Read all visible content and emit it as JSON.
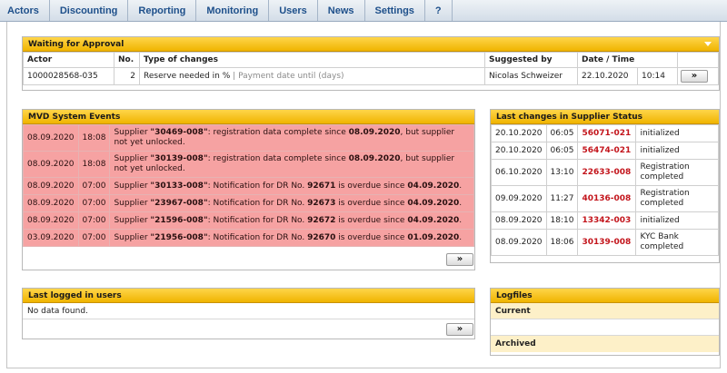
{
  "nav": {
    "items": [
      {
        "label": "Actors"
      },
      {
        "label": "Discounting"
      },
      {
        "label": "Reporting"
      },
      {
        "label": "Monitoring"
      },
      {
        "label": "Users"
      },
      {
        "label": "News"
      },
      {
        "label": "Settings"
      },
      {
        "label": "?"
      }
    ]
  },
  "approval": {
    "title": "Waiting for Approval",
    "columns": {
      "actor": "Actor",
      "no": "No.",
      "type": "Type of changes",
      "suggested": "Suggested by",
      "datetime": "Date / Time"
    },
    "rows": [
      {
        "actor": "1000028568-035",
        "no": "2",
        "type_main": "Reserve needed in %",
        "separator": "|",
        "type_secondary": "Payment date until (days)",
        "suggested_by": "Nicolas Schweizer",
        "date": "22.10.2020",
        "time": "10:14"
      }
    ],
    "more_label": "»"
  },
  "events": {
    "title": "MVD System Events",
    "rows": [
      {
        "date": "08.09.2020",
        "time": "18:08",
        "p1": "Supplier ",
        "id": "\"30469-008\"",
        "p2": ": registration data complete since ",
        "d2": "08.09.2020",
        "p3": ", but supplier not yet unlocked.",
        "p4": "",
        "p5": ""
      },
      {
        "date": "08.09.2020",
        "time": "18:08",
        "p1": "Supplier ",
        "id": "\"30139-008\"",
        "p2": ": registration data complete since ",
        "d2": "08.09.2020",
        "p3": ", but supplier not yet unlocked.",
        "p4": "",
        "p5": ""
      },
      {
        "date": "08.09.2020",
        "time": "07:00",
        "p1": "Supplier ",
        "id": "\"30133-008\"",
        "p2": ": Notification for DR No. ",
        "d2": "92671",
        "p3": " is overdue since ",
        "p4": "04.09.2020",
        "p5": "."
      },
      {
        "date": "08.09.2020",
        "time": "07:00",
        "p1": "Supplier ",
        "id": "\"23967-008\"",
        "p2": ": Notification for DR No. ",
        "d2": "92673",
        "p3": " is overdue since ",
        "p4": "04.09.2020",
        "p5": "."
      },
      {
        "date": "08.09.2020",
        "time": "07:00",
        "p1": "Supplier ",
        "id": "\"21596-008\"",
        "p2": ": Notification for DR No. ",
        "d2": "92672",
        "p3": " is overdue since ",
        "p4": "04.09.2020",
        "p5": "."
      },
      {
        "date": "03.09.2020",
        "time": "07:00",
        "p1": "Supplier ",
        "id": "\"21956-008\"",
        "p2": ": Notification for DR No. ",
        "d2": "92670",
        "p3": " is overdue since ",
        "p4": "01.09.2020",
        "p5": "."
      }
    ],
    "more_label": "»"
  },
  "status": {
    "title": "Last changes in Supplier Status",
    "rows": [
      {
        "date": "20.10.2020",
        "time": "06:05",
        "supplier": "56071-021",
        "status": "initialized"
      },
      {
        "date": "20.10.2020",
        "time": "06:05",
        "supplier": "56474-021",
        "status": "initialized"
      },
      {
        "date": "06.10.2020",
        "time": "13:10",
        "supplier": "22633-008",
        "status": "Registration completed"
      },
      {
        "date": "09.09.2020",
        "time": "11:27",
        "supplier": "40136-008",
        "status": "Registration completed"
      },
      {
        "date": "08.09.2020",
        "time": "18:10",
        "supplier": "13342-003",
        "status": "initialized"
      },
      {
        "date": "08.09.2020",
        "time": "18:06",
        "supplier": "30139-008",
        "status": "KYC Bank completed"
      }
    ]
  },
  "logged": {
    "title": "Last logged in users",
    "empty_text": "No data found.",
    "more_label": "»"
  },
  "logfiles": {
    "title": "Logfiles",
    "current_label": "Current",
    "archived_label": "Archived"
  }
}
